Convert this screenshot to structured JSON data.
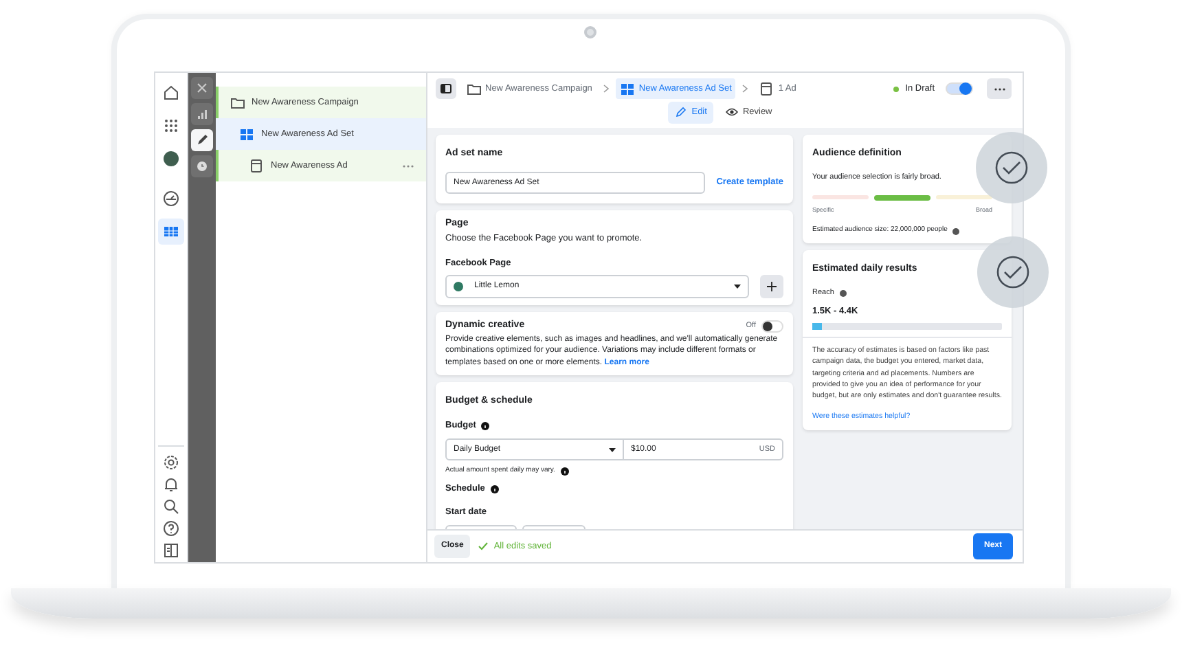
{
  "tree": [
    {
      "kind": "campaign",
      "label": "New Awareness Campaign",
      "selected": false
    },
    {
      "kind": "ad_set",
      "label": "New Awareness Ad Set",
      "selected": true
    },
    {
      "kind": "ad",
      "label": "New Awareness Ad",
      "selected": false
    }
  ],
  "rail_tools": [
    {
      "kind": "close",
      "selected": false
    },
    {
      "kind": "chart",
      "selected": false
    },
    {
      "kind": "edit",
      "selected": true
    },
    {
      "kind": "history",
      "selected": false
    }
  ],
  "nav_icons": [
    {
      "kind": "home",
      "selected": false
    },
    {
      "kind": "apps",
      "selected": false
    },
    {
      "kind": "account",
      "selected": false
    },
    {
      "kind": "gauge",
      "selected": false
    },
    {
      "kind": "table",
      "selected": true
    }
  ],
  "nav_bottom": [
    {
      "kind": "settings"
    },
    {
      "kind": "bell"
    },
    {
      "kind": "search"
    },
    {
      "kind": "help"
    },
    {
      "kind": "panel"
    }
  ],
  "breadcrumb": [
    {
      "kind": "campaign",
      "label": "New Awareness Campaign",
      "selected": false
    },
    {
      "kind": "ad_set",
      "label": "New Awareness Ad Set",
      "selected": true
    },
    {
      "kind": "ad",
      "label": "1 Ad",
      "selected": false
    }
  ],
  "status": {
    "label": "In Draft",
    "on": true
  },
  "mode_tabs": [
    {
      "kind": "edit",
      "label": "Edit",
      "selected": true
    },
    {
      "kind": "review",
      "label": "Review",
      "selected": false
    }
  ],
  "ad_set_name": {
    "title": "Ad set name",
    "value": "New Awareness Ad Set",
    "link": "Create template"
  },
  "page_section": {
    "title": "Page",
    "description": "Choose the Facebook Page you want to promote.",
    "field_label": "Facebook Page",
    "value": "Little Lemon"
  },
  "dynamic_creative": {
    "title": "Dynamic creative",
    "toggle_label": "Off",
    "on": false,
    "description": "Provide creative elements, such as images and headlines, and we'll automatically generate combinations optimized for your audience. Variations may include different formats or templates based on one or more elements.",
    "link": "Learn more"
  },
  "budget": {
    "title": "Budget & schedule",
    "budget_label": "Budget",
    "budget_type": "Daily Budget",
    "amount": "$10.00",
    "currency": "USD",
    "note": "Actual amount spent daily may vary.",
    "schedule_label": "Schedule",
    "start_date_label": "Start date"
  },
  "audience": {
    "title": "Audience definition",
    "text": "Your audience selection is fairly broad.",
    "segments": [
      {
        "color": "#f8dcd8",
        "selected": false
      },
      {
        "color": "#6bbd45",
        "selected": true
      },
      {
        "color": "#f7eccb",
        "selected": false
      }
    ],
    "low_label": "Specific",
    "high_label": "Broad",
    "size": "Estimated audience size: 22,000,000 people"
  },
  "estimates": {
    "title": "Estimated daily results",
    "reach_label": "Reach",
    "reach": "1.5K - 4.4K",
    "level": 0.05,
    "text": "The accuracy of estimates is based on factors like past campaign data, the budget you entered, market data, targeting criteria and ad placements. Numbers are provided to give you an idea of performance for your budget, but are only estimates and don't guarantee results.",
    "link": "Were these estimates helpful?"
  },
  "footer": {
    "close": "Close",
    "saved": "All edits saved",
    "next": "Next"
  }
}
